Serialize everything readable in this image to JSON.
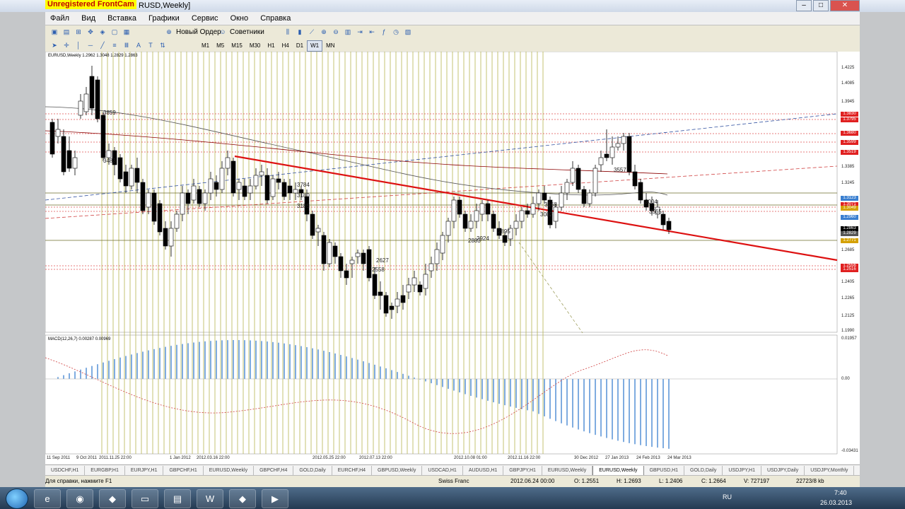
{
  "window": {
    "watermark": "Unregistered FrontCam",
    "title": "RUSD,Weekly]",
    "controls": [
      "–",
      "□",
      "✕"
    ]
  },
  "menu": [
    "Файл",
    "Вид",
    "Вставка",
    "Графики",
    "Сервис",
    "Окно",
    "Справка"
  ],
  "toolbar1": {
    "new_order": "Новый Ордер",
    "experts": "Советники"
  },
  "toolbar2": {
    "timeframes": [
      "M1",
      "M5",
      "M15",
      "M30",
      "H1",
      "H4",
      "D1",
      "W1",
      "MN"
    ],
    "active_timeframe": "W1"
  },
  "chart": {
    "header": "EURUSD,Weekly  1.2962 1.3048 1.2829 1.2863",
    "macd_label": "MACD(12,26,7)  0.00287 0.00969",
    "macd_right": {
      "top": "0.01957",
      "zero": "0.00",
      "bottom": "-0.03431"
    },
    "price_ticks": [
      "1.4225",
      "1.4085",
      "1.3945",
      "1.3385",
      "1.3245",
      "1.2825",
      "1.2685",
      "1.2405",
      "1.2265",
      "1.2125",
      "1.1990"
    ],
    "price_boxes": [
      {
        "label": "1.3830",
        "color": "#e02020"
      },
      {
        "label": "1.3795",
        "color": "#e02020"
      },
      {
        "label": "1.3680",
        "color": "#e02020"
      },
      {
        "label": "1.3599",
        "color": "#e02020"
      },
      {
        "label": "1.3519",
        "color": "#e02020"
      },
      {
        "label": "1.3123",
        "color": "#3a7fd0"
      },
      {
        "label": "1.3071",
        "color": "#e02020"
      },
      {
        "label": "1.3049",
        "color": "#d4a000"
      },
      {
        "label": "1.2960",
        "color": "#3a7fd0"
      },
      {
        "label": "1.2863",
        "color": "#000000"
      },
      {
        "label": "1.2829",
        "color": "#555555"
      },
      {
        "label": "1.2771",
        "color": "#d4a000"
      },
      {
        "label": "1.2556",
        "color": "#e02020"
      },
      {
        "label": "1.2516",
        "color": "#e02020"
      }
    ],
    "time_labels": [
      "11 Sep 2011",
      "9 Oct 2011",
      "2011.11.25 22:00",
      "1 Jan 2012",
      "2012.03.16 22:00",
      "2012.05.25 22:00",
      "2012.07.13 22:00",
      "2012.10.08 01:00",
      "2012.11.16 22:00",
      "30 Dec 2012",
      "27 Jan 2013",
      "24 Feb 2013",
      "24 Mar 2013"
    ],
    "annotations": [
      "3859",
      "3483",
      "3784",
      "3180",
      "3185",
      "2627",
      "2558",
      "2883",
      "2924",
      "2895",
      "3168",
      "3082",
      "3557",
      "3004",
      "3565"
    ],
    "colors": {
      "trend": "#dd1111",
      "vgrid": "#b8b450",
      "ma": "#8b0000",
      "macd": "#3a7fd0"
    }
  },
  "tabs": [
    "USDCHF,H1",
    "EURGBP,H1",
    "EURJPY,H1",
    "GBPCHF,H1",
    "EURUSD,Weekly",
    "GBPCHF,H4",
    "GOLD,Daily",
    "EURCHF,H4",
    "GBPUSD,Weekly",
    "USDCAD,H1",
    "AUDUSD,H1",
    "GBPJPY,H1",
    "EURUSD,Weekly",
    "EURUSD,Weekly",
    "GBPUSD,H1",
    "GOLD,Daily",
    "USDJPY,H1",
    "USDJPY,Daily",
    "USDJPY,Monthly",
    "USD..."
  ],
  "active_tab_index": 13,
  "status": {
    "help": "Для справки, нажмите F1",
    "symbol": "Swiss Franc",
    "time": "2012.06.24 00:00",
    "open": "O: 1.2551",
    "high": "H: 1.2693",
    "low": "L: 1.2406",
    "close": "C: 1.2664",
    "volume": "V: 727197",
    "traffic": "22723/8 kb"
  },
  "taskbar": {
    "lang": "RU",
    "time": "7:40",
    "date": "26.03.2013"
  }
}
